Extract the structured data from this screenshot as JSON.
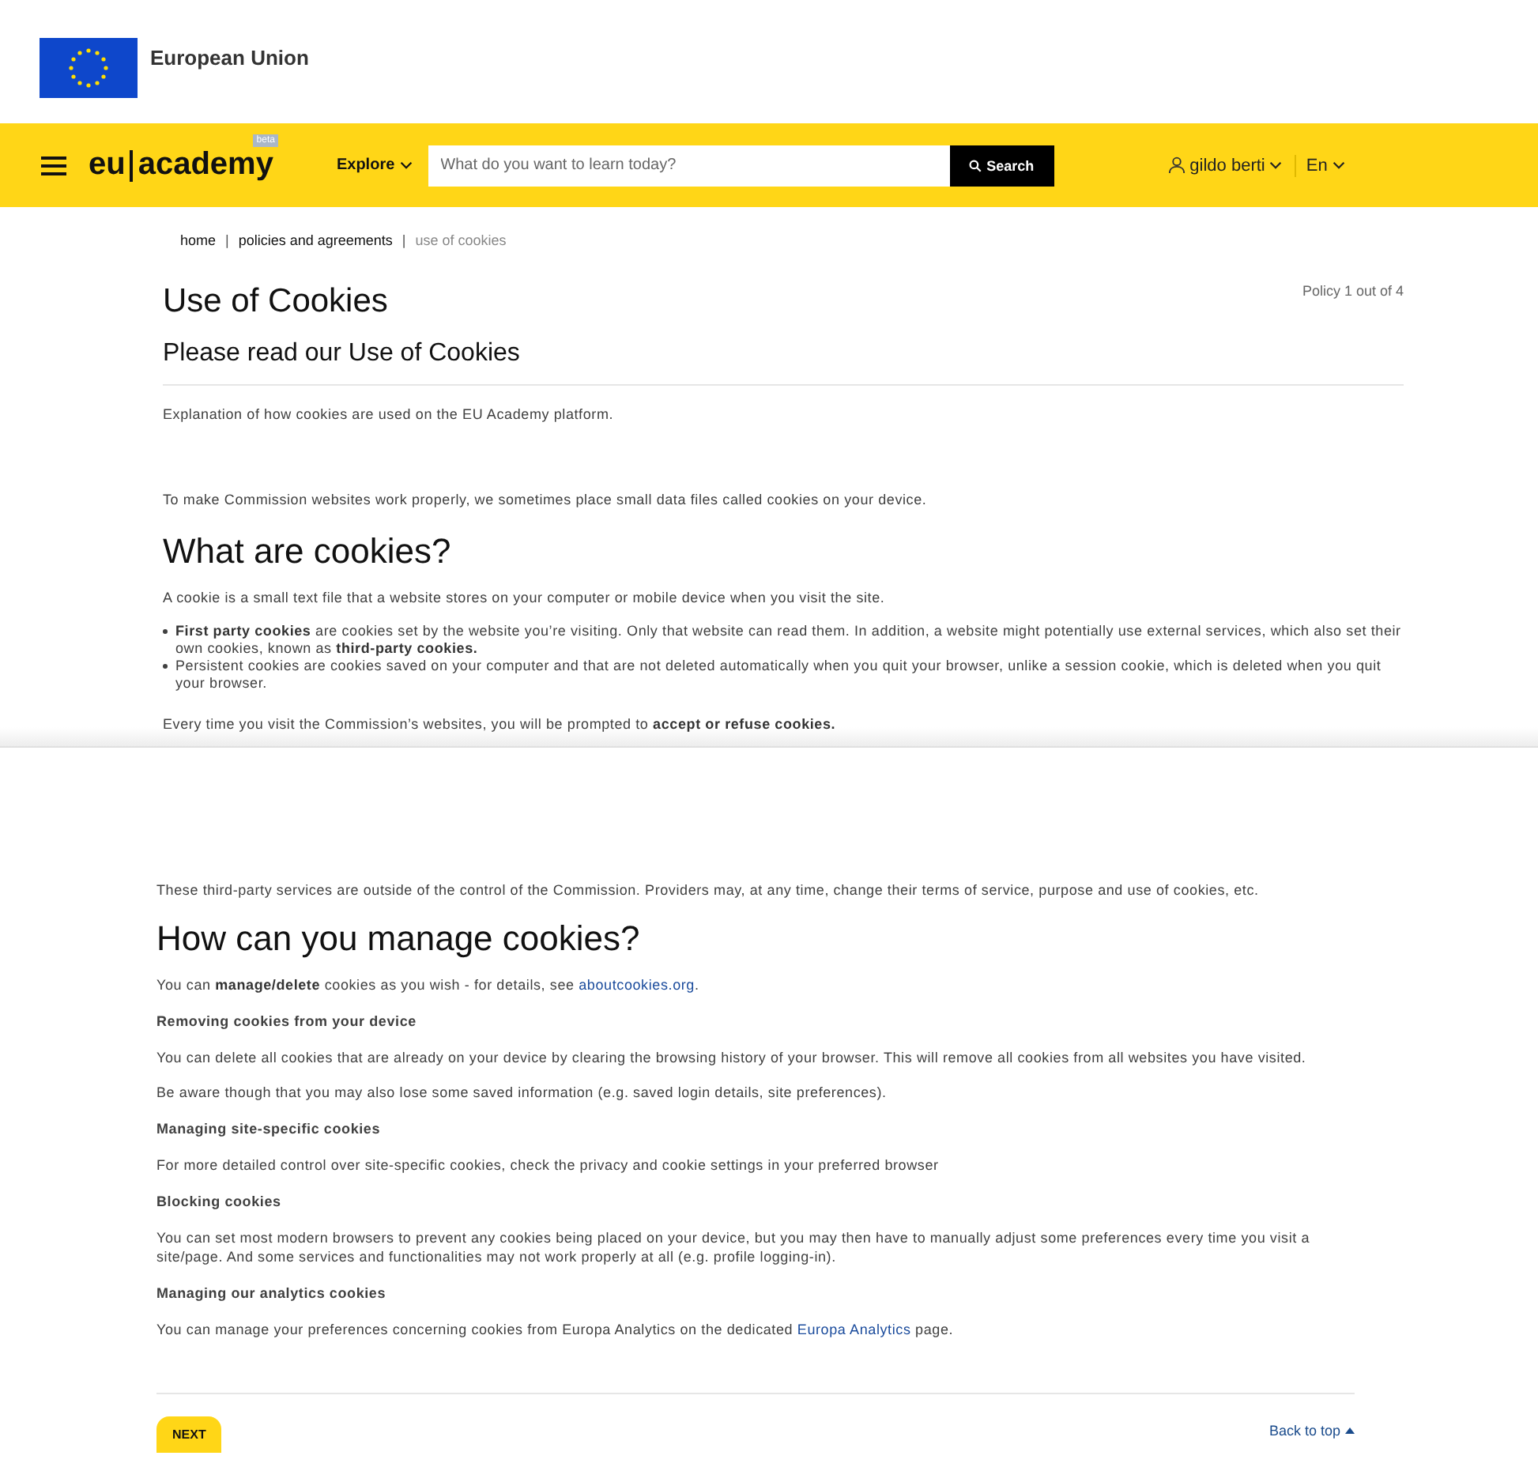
{
  "agency": {
    "name": "European Union"
  },
  "navbar": {
    "logo_left": "eu",
    "logo_right": "academy",
    "badge": "beta",
    "explore": "Explore",
    "search": {
      "placeholder": "What do you want to learn today?",
      "button": "Search"
    },
    "user": "gildo berti",
    "language": "En"
  },
  "breadcrumb": [
    {
      "label": "home",
      "current": false
    },
    {
      "separator": "|",
      "label": "policies and agreements",
      "current": false
    },
    {
      "separator": "|",
      "label": "use of cookies",
      "current": true
    }
  ],
  "page": {
    "title": "Use of Cookies",
    "counter": "Policy 1 out of 4",
    "subtitle": "Please read our Use of Cookies",
    "blocks": [
      {
        "kind": "lead",
        "text": "Explanation of how cookies are used on the EU Academy platform."
      },
      {
        "kind": "paragraph",
        "text": "To make Commission websites work properly, we sometimes place small data files called cookies on your device."
      },
      {
        "kind": "heading",
        "text": "What are cookies?"
      },
      {
        "kind": "paragraph",
        "text": "A cookie is a small text file that a website stores on your computer or mobile device when you visit the site."
      },
      {
        "kind": "list",
        "items": [
          "**First party cookies** are cookies set by the website you’re visiting. Only that website can read them. In addition, a website might potentially use external services, which also set their own cookies, known as **third-party cookies.**",
          "Persistent cookies are cookies saved on your computer and that are not deleted automatically when you quit your browser, unlike a session cookie, which is deleted when you quit your browser."
        ]
      },
      {
        "kind": "paragraph",
        "text": "Every time you visit the Commission’s websites, you will be prompted to **accept or refuse cookies.**"
      }
    ]
  },
  "continued": {
    "blocks": [
      {
        "kind": "paragraph",
        "text": "These third-party services are outside of the control of the Commission. Providers may, at any time, change their terms of service, purpose and use of cookies, etc."
      },
      {
        "kind": "heading",
        "text": "How can you manage cookies?"
      },
      {
        "kind": "linked",
        "before": "You can **manage/delete** cookies as you wish - for details, see ",
        "link": "aboutcookies.org",
        "after": "."
      },
      {
        "kind": "subheading",
        "text": "Removing cookies from your device"
      },
      {
        "kind": "paragraph",
        "text": "You can delete all cookies that are already on your device by clearing the browsing history of your browser. This will remove all cookies from all websites you have visited."
      },
      {
        "kind": "paragraph",
        "text": "Be aware though that you may also lose some saved information (e.g. saved login details, site preferences)."
      },
      {
        "kind": "subheading",
        "text": "Managing site-specific cookies"
      },
      {
        "kind": "paragraph",
        "text": "For more detailed control over site-specific cookies, check the privacy and cookie settings in your preferred browser"
      },
      {
        "kind": "subheading",
        "text": "Blocking cookies"
      },
      {
        "kind": "paragraph",
        "text": "You can set most modern browsers to prevent any cookies being placed on your device, but you may then have to manually adjust some preferences every time you visit a site/page. And some services and functionalities may not work properly at all (e.g. profile logging-in)."
      },
      {
        "kind": "subheading",
        "text": "Managing our analytics cookies"
      },
      {
        "kind": "linked",
        "before": "You can manage your preferences concerning cookies from Europa Analytics on the dedicated ",
        "link": "Europa Analytics",
        "after": " page."
      }
    ]
  },
  "footer": {
    "next": "NEXT",
    "back_to_top": "Back to top"
  }
}
